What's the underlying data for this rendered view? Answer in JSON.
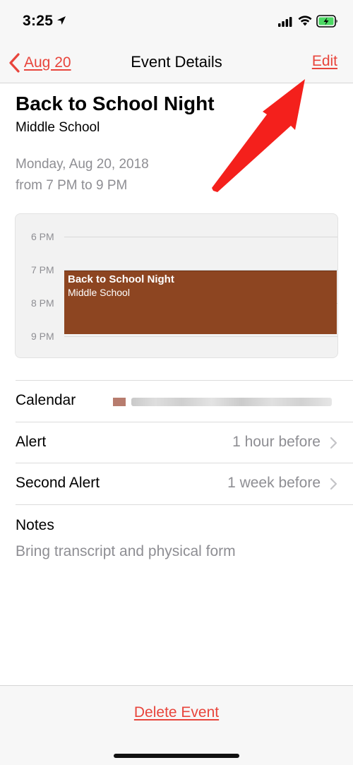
{
  "status_bar": {
    "time": "3:25",
    "icons": [
      "location-arrow-icon",
      "cellular-signal-icon",
      "wifi-icon",
      "battery-charging-icon"
    ],
    "battery_color": "#4cd964"
  },
  "nav": {
    "back_label": "Aug 20",
    "title": "Event Details",
    "edit_label": "Edit",
    "accent_color": "#e8453c"
  },
  "event": {
    "title": "Back to School Night",
    "location": "Middle School",
    "date": "Monday, Aug 20, 2018",
    "time_range": "from 7 PM to 9 PM"
  },
  "day_preview": {
    "hours": [
      "6 PM",
      "7 PM",
      "8 PM",
      "9 PM"
    ],
    "event_title": "Back to School Night",
    "event_location": "Middle School",
    "event_color": "#8d4521"
  },
  "details": {
    "calendar_label": "Calendar",
    "calendar_value_obscured": true,
    "alert_label": "Alert",
    "alert_value": "1 hour before",
    "second_alert_label": "Second Alert",
    "second_alert_value": "1 week before",
    "notes_label": "Notes",
    "notes_text": "Bring transcript and physical form"
  },
  "footer": {
    "delete_label": "Delete Event"
  },
  "annotation": {
    "arrow_color": "#f4201c",
    "points_to": "edit-button"
  }
}
